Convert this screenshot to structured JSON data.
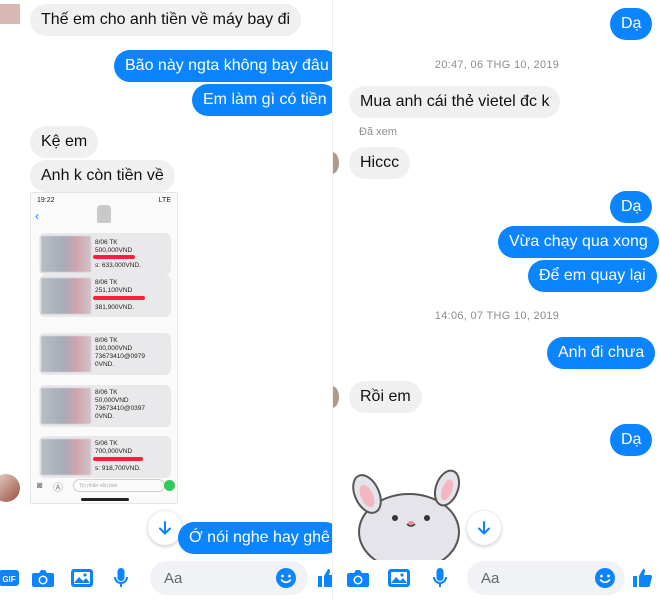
{
  "left": {
    "messages": {
      "m1": "Thế em cho anh tiền về máy bay đi",
      "m2": "Bão này ngta không bay đâu",
      "m3": "Em làm gì có tiền",
      "m4": "Kệ em",
      "m5": "Anh k còn tiền về",
      "m6": "Ớ nói nghe hay ghê"
    },
    "screenshot": {
      "status_time": "19:22",
      "status_right": "LTE",
      "sms": [
        {
          "l1": "8/06 TK",
          "l2": "500,000VND",
          "l3": "s: 633,000VND."
        },
        {
          "l1": "8/06 TK",
          "l2": "251,100VND",
          "l3": "381,900VND."
        },
        {
          "l1": "8/06 TK",
          "l2": "100,000VND",
          "l3": "73673410@0979",
          "l4": "0VND."
        },
        {
          "l1": "8/06 TK",
          "l2": "50,000VND",
          "l3": "73673410@0397",
          "l4": "0VND."
        },
        {
          "l1": "5/06 TK",
          "l2": "700,000VND",
          "l3": "s: 918,700VND."
        }
      ],
      "input_placeholder": "Tin nhắn văn bản"
    },
    "composer": {
      "placeholder": "Aa"
    }
  },
  "right": {
    "messages": {
      "r1": "Dạ",
      "ts1": "20:47, 06 THG 10, 2019",
      "r2": "Mua anh cái thẻ vietel đc k",
      "seen": "Đã xem",
      "r3": "Hiccc",
      "r4": "Dạ",
      "r5": "Vừa chạy qua xong",
      "r6": "Để em quay lại",
      "ts2": "14:06, 07 THG 10, 2019",
      "r7": "Anh đi chưa",
      "r8": "Rồi em",
      "r9": "Dạ"
    },
    "composer": {
      "placeholder": "Aa"
    }
  },
  "colors": {
    "accent": "#0a84ff",
    "incoming": "#f0f0f0",
    "timestamp": "#8a8d91"
  }
}
